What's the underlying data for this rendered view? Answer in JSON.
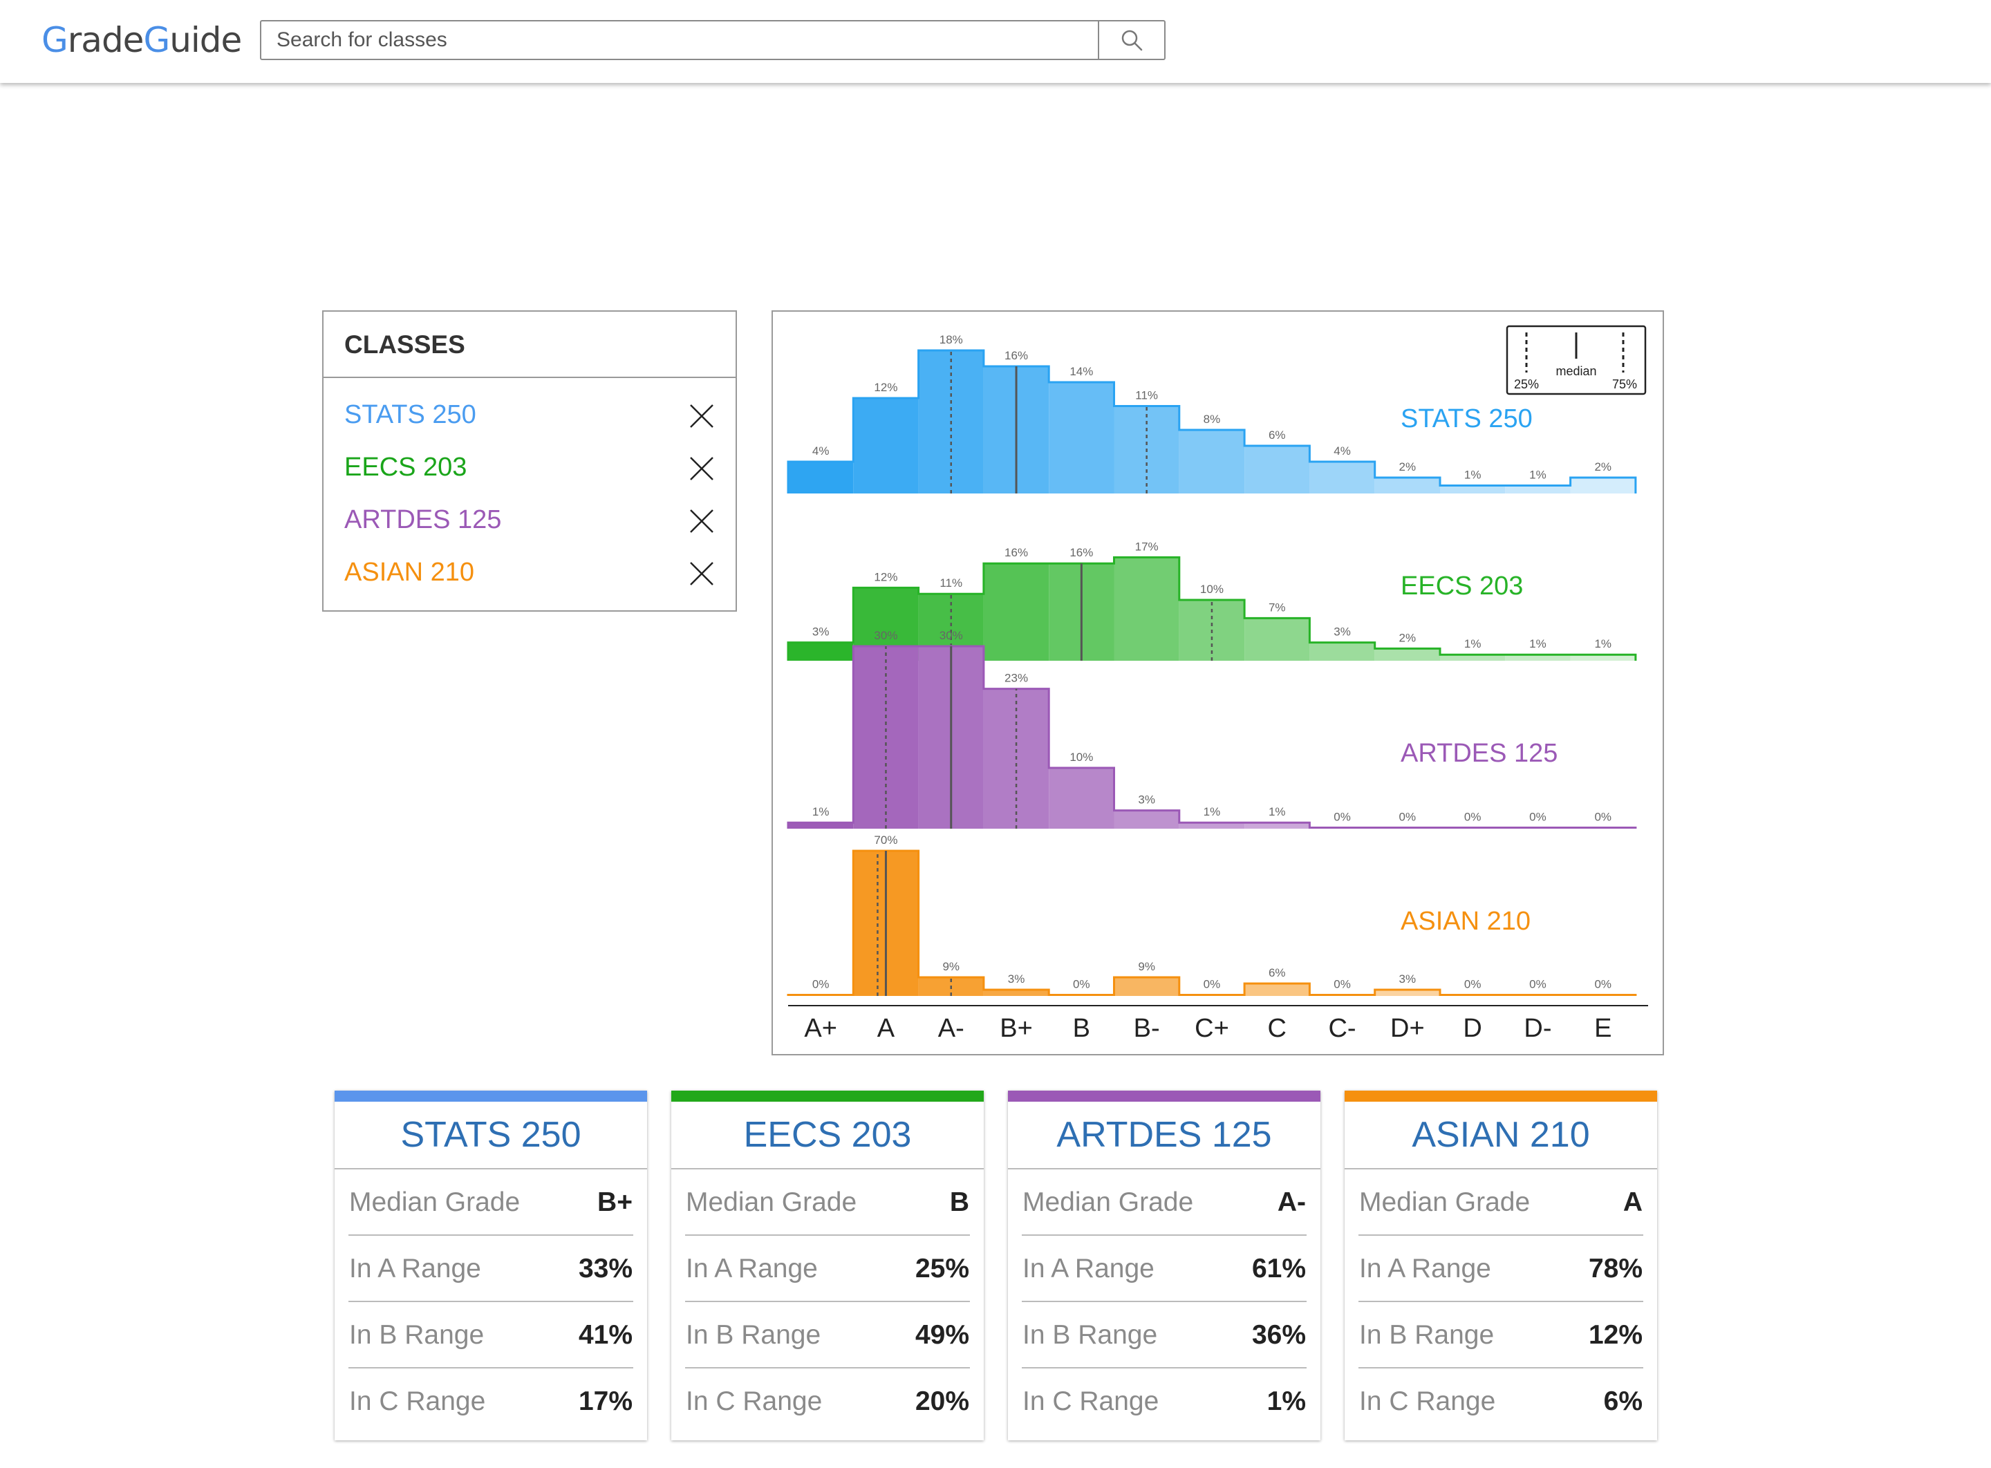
{
  "app": {
    "logo_parts": [
      "G",
      "rade",
      "G",
      "uide"
    ]
  },
  "search": {
    "placeholder": "Search for classes",
    "value": ""
  },
  "classes_panel": {
    "title": "CLASSES",
    "items": [
      {
        "label": "STATS 250",
        "color": "#4a9cf0"
      },
      {
        "label": "EECS 203",
        "color": "#1aa51a"
      },
      {
        "label": "ARTDES 125",
        "color": "#9b59b6"
      },
      {
        "label": "ASIAN 210",
        "color": "#f5900f"
      }
    ]
  },
  "legend": {
    "q1": "25%",
    "median": "median",
    "q3": "75%"
  },
  "chart_data": {
    "type": "bar",
    "categories": [
      "A+",
      "A",
      "A-",
      "B+",
      "B",
      "B-",
      "C+",
      "C",
      "C-",
      "D+",
      "D",
      "D-",
      "E"
    ],
    "ylim": [
      0,
      100
    ],
    "series": [
      {
        "name": "STATS 250",
        "color": "#2aa3f2",
        "values": [
          4,
          12,
          18,
          16,
          14,
          11,
          8,
          6,
          4,
          2,
          1,
          1,
          2
        ],
        "q1": "A-",
        "median": "B+",
        "q3": "B-"
      },
      {
        "name": "EECS 203",
        "color": "#27b327",
        "values": [
          3,
          12,
          11,
          16,
          16,
          17,
          10,
          7,
          3,
          2,
          1,
          1,
          1
        ],
        "q1": "A-",
        "median": "B",
        "q3": "C+"
      },
      {
        "name": "ARTDES 125",
        "color": "#9b59b6",
        "values": [
          1,
          30,
          30,
          23,
          10,
          3,
          1,
          1,
          0,
          0,
          0,
          0,
          0
        ],
        "q1": "A",
        "median": "A-",
        "q3": "B+"
      },
      {
        "name": "ASIAN 210",
        "color": "#f5900f",
        "values": [
          0,
          70,
          9,
          3,
          0,
          9,
          0,
          6,
          0,
          3,
          0,
          0,
          0
        ],
        "q1": "A",
        "median": "A",
        "q3": "A-"
      }
    ]
  },
  "cards": [
    {
      "title": "STATS 250",
      "color": "#5b95ec",
      "rows": [
        {
          "label": "Median Grade",
          "value": "B+"
        },
        {
          "label": "In A Range",
          "value": "33%"
        },
        {
          "label": "In B Range",
          "value": "41%"
        },
        {
          "label": "In C Range",
          "value": "17%"
        }
      ]
    },
    {
      "title": "EECS 203",
      "color": "#22a81a",
      "rows": [
        {
          "label": "Median Grade",
          "value": "B"
        },
        {
          "label": "In A Range",
          "value": "25%"
        },
        {
          "label": "In B Range",
          "value": "49%"
        },
        {
          "label": "In C Range",
          "value": "20%"
        }
      ]
    },
    {
      "title": "ARTDES 125",
      "color": "#9b59b6",
      "rows": [
        {
          "label": "Median Grade",
          "value": "A-"
        },
        {
          "label": "In A Range",
          "value": "61%"
        },
        {
          "label": "In B Range",
          "value": "36%"
        },
        {
          "label": "In C Range",
          "value": "1%"
        }
      ]
    },
    {
      "title": "ASIAN 210",
      "color": "#f5900f",
      "rows": [
        {
          "label": "Median Grade",
          "value": "A"
        },
        {
          "label": "In A Range",
          "value": "78%"
        },
        {
          "label": "In B Range",
          "value": "12%"
        },
        {
          "label": "In C Range",
          "value": "6%"
        }
      ]
    }
  ]
}
